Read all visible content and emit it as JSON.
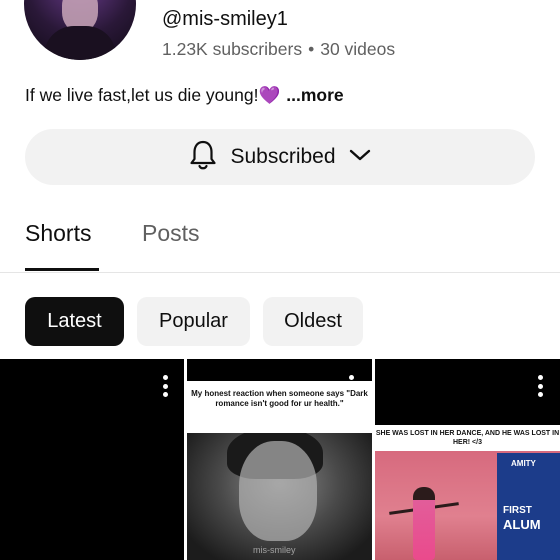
{
  "channel": {
    "handle": "@mis-smiley1",
    "subscribers": "1.23K subscribers",
    "separator": "•",
    "videos": "30 videos",
    "bio": "If we live fast,let us die young!",
    "bio_emoji": "💜",
    "more_label": "...more"
  },
  "subscribe_button": {
    "label": "Subscribed",
    "icons": [
      "bell-icon",
      "chevron-down-icon"
    ]
  },
  "tabs": [
    {
      "label": "Shorts",
      "selected": true
    },
    {
      "label": "Posts",
      "selected": false
    }
  ],
  "filters": [
    {
      "label": "Latest",
      "selected": true
    },
    {
      "label": "Popular",
      "selected": false
    },
    {
      "label": "Oldest",
      "selected": false
    }
  ],
  "shorts": [
    {
      "caption": ""
    },
    {
      "caption": "My honest reaction when someone says \"Dark romance isn't good for ur health.\"",
      "watermark": "mis-smiley"
    },
    {
      "caption": "SHE WAS LOST IN HER DANCE, AND HE WAS LOST IN HER! </3",
      "banner_brand": "AMITY",
      "banner_line1": "FIRST",
      "banner_line2": "ALUM"
    }
  ],
  "colors": {
    "primary_text": "#0f0f0f",
    "secondary_text": "#606060",
    "chip_bg": "#f2f2f2",
    "chip_selected_bg": "#0f0f0f",
    "heart": "#7b2fbe"
  }
}
